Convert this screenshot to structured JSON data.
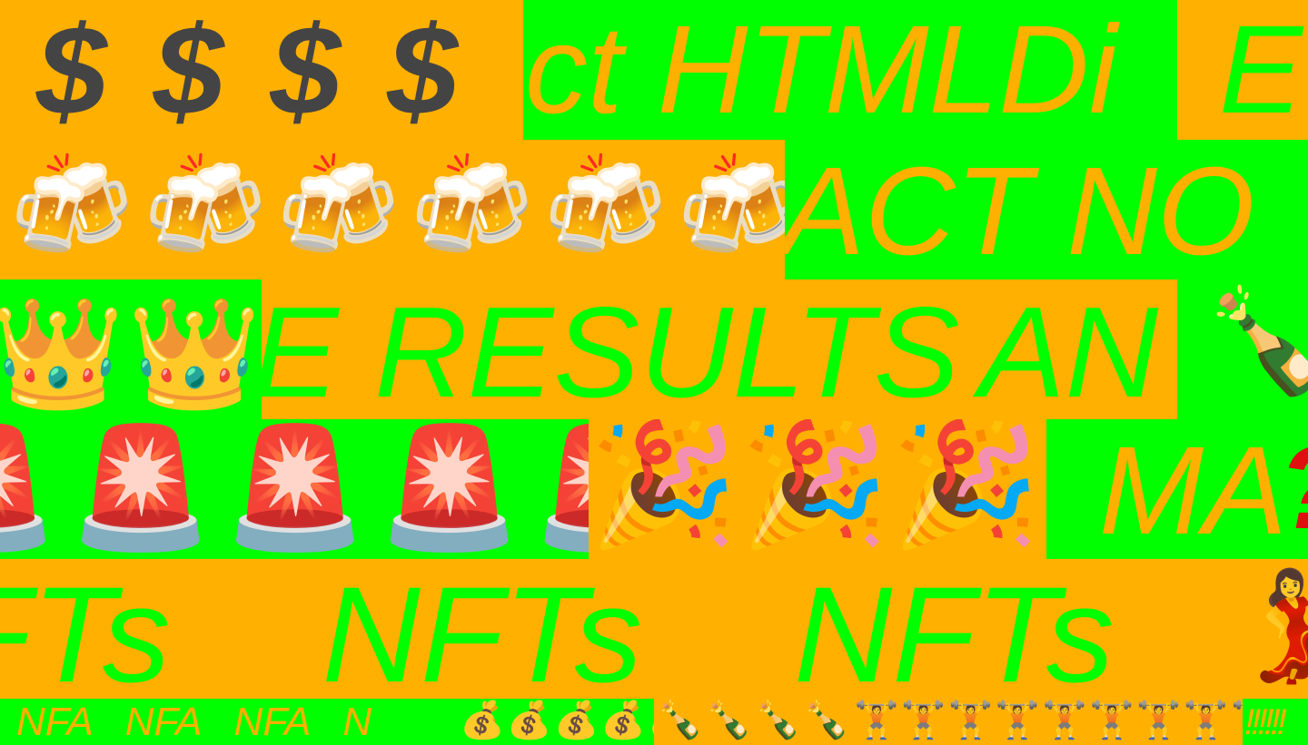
{
  "colors": {
    "orange": "#FFB000",
    "green": "#00FF00",
    "grey": "#444444",
    "red": "#E01010"
  },
  "tiles": {
    "dollars": "$ $ $ $",
    "html_text": "ct HTMLDi",
    "e_text": "E",
    "beers": "🍻🍻🍻🍻🍻🍻🍻",
    "act_text": "ACT NO",
    "crowns": "👑👑👑",
    "results_text": "E RESULTS",
    "an_text": "AN",
    "champagne": "🍾",
    "sirens": "🚨🚨🚨🚨🚨",
    "party": "🎉🎉🎉🎉",
    "ma_text": "MA",
    "question": "?",
    "nfts_text": "NFTs    NFTs    NFTs",
    "dancer": "💃",
    "nfa_text": "NFA   NFA   NFA   N",
    "money_bags": "💰💰💰💰💰",
    "bottles": "🍾🍾🍾🍾🍾",
    "lifters": "🏋🏋🏋🏋🏋🏋🏋🏋🏋🏋",
    "bangs": "!!!!!!"
  }
}
